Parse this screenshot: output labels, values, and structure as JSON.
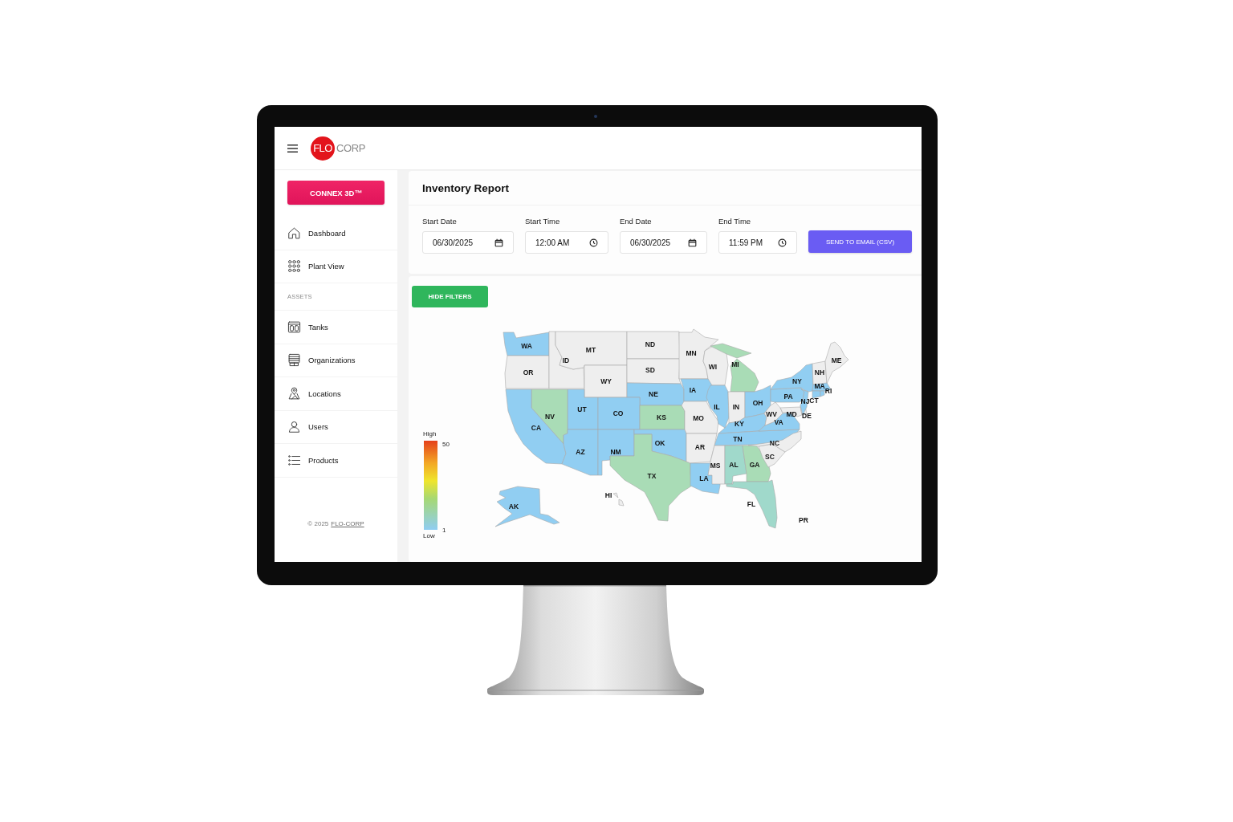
{
  "header": {
    "logo_mark": "FLO",
    "logo_text": "CORP"
  },
  "sidebar": {
    "button": "CONNEX 3D™",
    "nav": [
      {
        "kind": "link",
        "label": "Dashboard"
      },
      {
        "kind": "link",
        "label": "Plant View"
      },
      {
        "kind": "section",
        "label": "ASSETS"
      },
      {
        "kind": "link",
        "label": "Tanks"
      },
      {
        "kind": "link",
        "label": "Organizations"
      },
      {
        "kind": "link",
        "label": "Locations"
      },
      {
        "kind": "link",
        "label": "Users"
      },
      {
        "kind": "link",
        "label": "Products"
      }
    ],
    "footer": {
      "text": "© 2025",
      "link": "FLO-CORP"
    }
  },
  "report": {
    "title": "Inventory Report",
    "filters": [
      {
        "kind": "date",
        "label": "Start Date",
        "value": "06/30/2025"
      },
      {
        "kind": "time",
        "label": "Start Time",
        "value": "12:00 AM"
      },
      {
        "kind": "date",
        "label": "End Date",
        "value": "06/30/2025"
      },
      {
        "kind": "time",
        "label": "End Time",
        "value": "11:59 PM"
      }
    ],
    "send_button": "SEND TO EMAIL (CSV)"
  },
  "map": {
    "toggle_button": "HIDE FILTERS",
    "legend": {
      "high_label": "High",
      "max": "50",
      "min": "1",
      "low_label": "Low"
    },
    "states": [
      {
        "label": "WA",
        "color": "#91cef2"
      },
      {
        "label": "OR",
        "color": "#eeeeee"
      },
      {
        "label": "ID",
        "color": "#eeeeee"
      },
      {
        "label": "MT",
        "color": "#eeeeee"
      },
      {
        "label": "WY",
        "color": "#eeeeee"
      },
      {
        "label": "ND",
        "color": "#eeeeee"
      },
      {
        "label": "SD",
        "color": "#eeeeee"
      },
      {
        "label": "MN",
        "color": "#eeeeee"
      },
      {
        "label": "WI",
        "color": "#eeeeee"
      },
      {
        "label": "MI",
        "color": "#a9dcb6"
      },
      {
        "label": "NE",
        "color": "#91cef2"
      },
      {
        "label": "IA",
        "color": "#91cef2"
      },
      {
        "label": "UT",
        "color": "#91cef2"
      },
      {
        "label": "CO",
        "color": "#91cef2"
      },
      {
        "label": "NV",
        "color": "#a9dcb6"
      },
      {
        "label": "CA",
        "color": "#91cef2"
      },
      {
        "label": "AZ",
        "color": "#91cef2"
      },
      {
        "label": "NM",
        "color": "#91cef2"
      },
      {
        "label": "KS",
        "color": "#a9dcb6"
      },
      {
        "label": "OK",
        "color": "#91cef2"
      },
      {
        "label": "TX",
        "color": "#a9dcb6"
      },
      {
        "label": "MO",
        "color": "#eeeeee"
      },
      {
        "label": "IL",
        "color": "#91cef2"
      },
      {
        "label": "IN",
        "color": "#eeeeee"
      },
      {
        "label": "OH",
        "color": "#91cef2"
      },
      {
        "label": "KY",
        "color": "#91cef2"
      },
      {
        "label": "TN",
        "color": "#91cef2"
      },
      {
        "label": "AR",
        "color": "#eeeeee"
      },
      {
        "label": "LA",
        "color": "#91cef2"
      },
      {
        "label": "MS",
        "color": "#eeeeee"
      },
      {
        "label": "AL",
        "color": "#a0d9cb"
      },
      {
        "label": "GA",
        "color": "#a9dcb6"
      },
      {
        "label": "FL",
        "color": "#a0d9cb"
      },
      {
        "label": "SC",
        "color": "#eeeeee"
      },
      {
        "label": "NC",
        "color": "#eeeeee"
      },
      {
        "label": "VA",
        "color": "#91cef2"
      },
      {
        "label": "WV",
        "color": "#eeeeee"
      },
      {
        "label": "MD",
        "color": "#eeeeee"
      },
      {
        "label": "DE",
        "color": "#eeeeee"
      },
      {
        "label": "PA",
        "color": "#91cef2"
      },
      {
        "label": "NJ",
        "color": "#91cef2"
      },
      {
        "label": "NY",
        "color": "#91cef2"
      },
      {
        "label": "NH",
        "color": "#eeeeee"
      },
      {
        "label": "ME",
        "color": "#eeeeee"
      },
      {
        "label": "MA",
        "color": "#91cef2"
      },
      {
        "label": "CT",
        "color": "#91cef2"
      },
      {
        "label": "RI",
        "color": "#91cef2"
      },
      {
        "label": "AK",
        "color": "#91cef2"
      },
      {
        "label": "HI",
        "color": "#eeeeee"
      },
      {
        "label": "PR"
      }
    ]
  }
}
